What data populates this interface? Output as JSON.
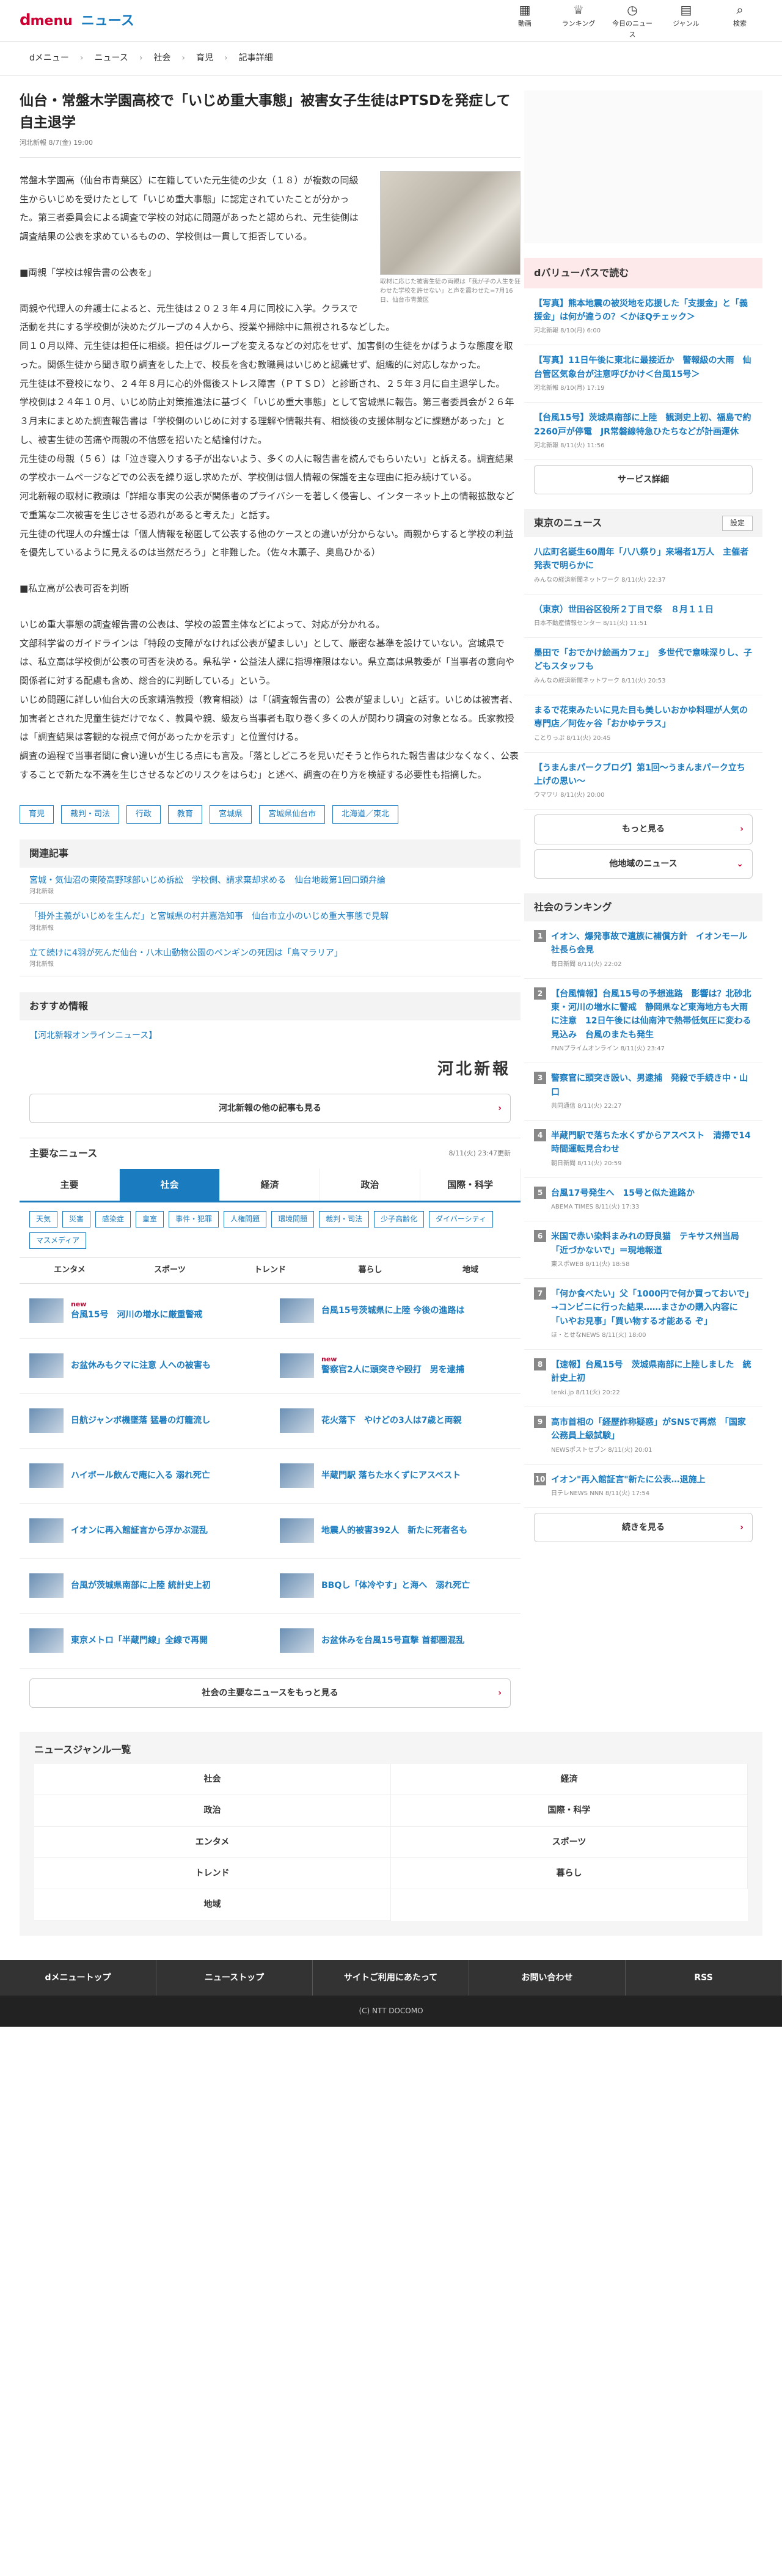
{
  "header": {
    "logo_d": "d",
    "logo_menu": "menu",
    "logo_news": "ニュース",
    "nav": [
      {
        "icon": "▦",
        "label": "動画"
      },
      {
        "icon": "♕",
        "label": "ランキング"
      },
      {
        "icon": "◷",
        "label": "今日のニュース"
      },
      {
        "icon": "▤",
        "label": "ジャンル"
      },
      {
        "icon": "⌕",
        "label": "検索"
      }
    ]
  },
  "breadcrumb": [
    "dメニュー",
    "ニュース",
    "社会",
    "育児",
    "記事詳細"
  ],
  "article": {
    "title": "仙台・常盤木学園高校で「いじめ重大事態」被害女子生徒はPTSDを発症して自主退学",
    "meta": "河北新報 8/7(金) 19:00",
    "caption": "取材に応じた被害生徒の両親は「我が子の人生を狂わせた学校を許せない」と声を震わせた=7月16日、仙台市青葉区",
    "p1": "常盤木学園高（仙台市青葉区）に在籍していた元生徒の少女（１８）が複数の同級生からいじめを受けたとして「いじめ重大事態」に認定されていたことが分かった。第三者委員会による調査で学校の対応に問題があったと認められ、元生徒側は調査結果の公表を求めているものの、学校側は一貫して拒否している。",
    "h1": "■両親「学校は報告書の公表を」",
    "p2": "両親や代理人の弁護士によると、元生徒は２０２３年４月に同校に入学。クラスで活動を共にする学校側が決めたグループの４人から、授業や掃除中に無視されるなどした。",
    "p3": "同１０月以降、元生徒は担任に相談。担任はグループを変えるなどの対応をせず、加害側の生徒をかばうような態度を取った。関係生徒から聞き取り調査をした上で、校長を含む教職員はいじめと認識せず、組織的に対応しなかった。",
    "p4": "元生徒は不登校になり、２４年８月に心的外傷後ストレス障害（ＰＴＳＤ）と診断され、２５年３月に自主退学した。",
    "p5": "学校側は２４年１０月、いじめ防止対策推進法に基づく「いじめ重大事態」として宮城県に報告。第三者委員会が２６年３月末にまとめた調査報告書は「学校側のいじめに対する理解や情報共有、相談後の支援体制などに課題があった」とし、被害生徒の苦痛や両親の不信感を招いたと結論付けた。",
    "p6": "元生徒の母親（５６）は「泣き寝入りする子が出ないよう、多くの人に報告書を読んでもらいたい」と訴える。調査結果の学校ホームページなどでの公表を繰り返し求めたが、学校側は個人情報の保護を主な理由に拒み続けている。",
    "p7": "河北新報の取材に教頭は「詳細な事実の公表が関係者のプライバシーを著しく侵害し、インターネット上の情報拡散などで重篤な二次被害を生じさせる恐れがあると考えた」と話す。",
    "p8": "元生徒の代理人の弁護士は「個人情報を秘匿して公表する他のケースとの違いが分からない。両親からすると学校の利益を優先しているように見えるのは当然だろう」と非難した。（佐々木薫子、奥島ひかる）",
    "h2": "■私立高が公表可否を判断",
    "p9": "いじめ重大事態の調査報告書の公表は、学校の設置主体などによって、対応が分かれる。",
    "p10": "文部科学省のガイドラインは「特段の支障がなければ公表が望ましい」として、厳密な基準を設けていない。宮城県では、私立高は学校側が公表の可否を決める。県私学・公益法人課に指導権限はない。県立高は県教委が「当事者の意向や関係者に対する配慮も含め、総合的に判断している」という。",
    "p11": "いじめ問題に詳しい仙台大の氏家靖浩教授（教育相談）は「（調査報告書の）公表が望ましい」と話す。いじめは被害者、加害者とされた児童生徒だけでなく、教員や親、級友ら当事者も取り巻く多くの人が関わり調査の対象となる。氏家教授は「調査結果は客観的な視点で何があったかを示す」と位置付ける。",
    "p12": "調査の過程で当事者間に食い違いが生じる点にも言及。「落としどころを見いだそうと作られた報告書は少なくなく、公表することで新たな不満を生じさせるなどのリスクをはらむ」と述べ、調査の在り方を検証する必要性も指摘した。",
    "tags": [
      "育児",
      "裁判・司法",
      "行政",
      "教育",
      "宮城県",
      "宮城県仙台市",
      "北海道／東北"
    ]
  },
  "related": {
    "heading": "関連記事",
    "items": [
      {
        "t": "宮城・気仙沼の東陵高野球部いじめ訴訟　学校側、請求棄却求める　仙台地裁第1回口頭弁論",
        "s": "河北新報"
      },
      {
        "t": "「掛外主義がいじめを生んだ」と宮城県の村井嘉浩知事　仙台市立小のいじめ重大事態で見解",
        "s": "河北新報"
      },
      {
        "t": "立て続けに4羽が死んだ仙台・八木山動物公園のペンギンの死因は「鳥マラリア」",
        "s": "河北新報"
      }
    ]
  },
  "recommend": {
    "heading": "おすすめ情報",
    "link": "【河北新報オンラインニュース】",
    "kahoku": "河北新報",
    "more": "河北新報の他の記事も見る"
  },
  "mainnews": {
    "heading": "主要なニュース",
    "time": "8/11(火) 23:47更新",
    "tabs": [
      "主要",
      "社会",
      "経済",
      "政治",
      "国際・科学"
    ],
    "chips": [
      "天気",
      "災害",
      "感染症",
      "皇室",
      "事件・犯罪",
      "人権問題",
      "環境問題",
      "裁判・司法",
      "少子高齢化",
      "ダイバーシティ",
      "マスメディア"
    ],
    "subtabs": [
      "エンタメ",
      "スポーツ",
      "トレンド",
      "暮らし",
      "地域"
    ],
    "items": [
      {
        "t": "台風15号　河川の増水に厳重警戒",
        "new": "new"
      },
      {
        "t": "台風15号茨城県に上陸 今後の進路は",
        "new": ""
      },
      {
        "t": "お盆休みもクマに注意 人への被害も",
        "new": ""
      },
      {
        "t": "警察官2人に頭突きや殴打　男を逮捕",
        "new": "new"
      },
      {
        "t": "日航ジャンボ機墜落 猛暑の灯籠流し",
        "new": ""
      },
      {
        "t": "花火落下　やけどの3人は7歳と両親",
        "new": ""
      },
      {
        "t": "ハイボール飲んで庵に入る 溺れ死亡",
        "new": ""
      },
      {
        "t": "半蔵門駅 落ちた水くずにアスベスト",
        "new": ""
      },
      {
        "t": "イオンに再入館証言から浮かぶ混乱",
        "new": ""
      },
      {
        "t": "地震人的被害392人　新たに死者名も",
        "new": ""
      },
      {
        "t": "台風が茨城県南部に上陸 統計史上初",
        "new": ""
      },
      {
        "t": "BBQし「体冷やす」と海へ　溺れ死亡",
        "new": ""
      },
      {
        "t": "東京メトロ「半蔵門線」全線で再開",
        "new": ""
      },
      {
        "t": "お盆休みを台風15号直撃 首都圏混乱",
        "new": ""
      }
    ],
    "more": "社会の主要なニュースをもっと見る"
  },
  "genre": {
    "heading": "ニュースジャンル一覧",
    "items": [
      "社会",
      "経済",
      "政治",
      "国際・科学",
      "エンタメ",
      "スポーツ",
      "トレンド",
      "暮らし",
      "地域"
    ]
  },
  "footer": {
    "nav": [
      "dメニュートップ",
      "ニューストップ",
      "サイトご利用にあたって",
      "お問い合わせ",
      "RSS"
    ],
    "copy": "(C) NTT DOCOMO"
  },
  "side": {
    "dvalue": {
      "heading": "dバリューパスで読む",
      "items": [
        {
          "t": "【写真】熊本地震の被災地を応援した「支援金」と「義援金」は何が違うの？＜かほQチェック＞",
          "s": "河北新報 8/10(月) 6:00"
        },
        {
          "t": "【写真】11日午後に東北に最接近か　警報級の大雨　仙台管区気象台が注意呼びかけ＜台風15号＞",
          "s": "河北新報 8/10(月) 17:19"
        },
        {
          "t": "【台風15号】茨城県南部に上陸　観測史上初、福島で約2260戸が停電　JR常磐線特急ひたちなどが計画運休",
          "s": "河北新報 8/11(火) 11:56"
        }
      ],
      "btn": "サービス詳細"
    },
    "tokyo": {
      "heading": "東京のニュース",
      "setting": "設定",
      "items": [
        {
          "t": "八広町名誕生60周年「八八祭り」来場者1万人　主催者発表で明らかに",
          "s": "みんなの経済新聞ネットワーク 8/11(火) 22:37"
        },
        {
          "t": "（東京）世田谷区役所２丁目で祭　８月１１日",
          "s": "日本不動産情報センター 8/11(火) 11:51"
        },
        {
          "t": "墨田で「おでかけ絵画カフェ」　多世代で意味深りし、子どもスタッフも",
          "s": "みんなの経済新聞ネットワーク 8/11(火) 20:53"
        },
        {
          "t": "まるで花束みたいに見た目も美しいおかゆ料理が人気の専門店／阿佐ヶ谷「おかゆテラス」",
          "s": "ことりっぷ 8/11(火) 20:45"
        },
        {
          "t": "【うまんまパークブログ】第1回〜うまんまパーク立ち上げの思い〜",
          "s": "ウマワリ 8/11(火) 20:00"
        }
      ],
      "more": "もっと見る",
      "other": "他地域のニュース"
    },
    "ranking": {
      "heading": "社会のランキング",
      "items": [
        {
          "t": "イオン、爆発事故で遺族に補償方針　イオンモール社長ら会見",
          "s": "毎日新聞 8/11(火) 22:02"
        },
        {
          "t": "【台風情報】台風15号の予想進路　影響は？北砂北東・河川の増水に警戒　静岡県など東海地方も大雨に注意　12日午後には仙南沖で熱帯低気圧に変わる見込み　台風のまたも発生",
          "s": "FNNプライムオンライン 8/11(火) 23:47"
        },
        {
          "t": "警察官に頭突き殴い、男逮捕　発殺で手続き中・山口",
          "s": "共同通信 8/11(火) 22:27"
        },
        {
          "t": "半蔵門駅で落ちた水くずからアスベスト　清掃で14時間運転見合わせ",
          "s": "朝日新聞 8/11(火) 20:59"
        },
        {
          "t": "台風17号発生へ　15号と似た進路か",
          "s": "ABEMA TIMES 8/11(火) 17:33"
        },
        {
          "t": "米国で赤い染料まみれの野良猫　テキサス州当局「近づかないで」＝現地報道",
          "s": "東スポWEB 8/11(火) 18:58"
        },
        {
          "t": "「何か食べたい」父「1000円で何か買っておいで」→コンビニに行った結果……まさかの購入内容に「いやお見事」「買い物するオ能ある ぞ」",
          "s": "ほ・とせなNEWS 8/11(火) 18:00"
        },
        {
          "t": "【速報】台風15号　茨城県南部に上陸しました　統計史上初",
          "s": "tenki.jp 8/11(火) 20:22"
        },
        {
          "t": "高市首相の「経歴詐称疑惑」がSNSで再燃　「国家公務員上級試験」",
          "s": "NEWSポストセブン 8/11(火) 20:01"
        },
        {
          "t": "イオン\"再入館証言\"新たに公表…退施上",
          "s": "日テレNEWS NNN 8/11(火) 17:54"
        }
      ],
      "more": "続きを見る"
    }
  }
}
